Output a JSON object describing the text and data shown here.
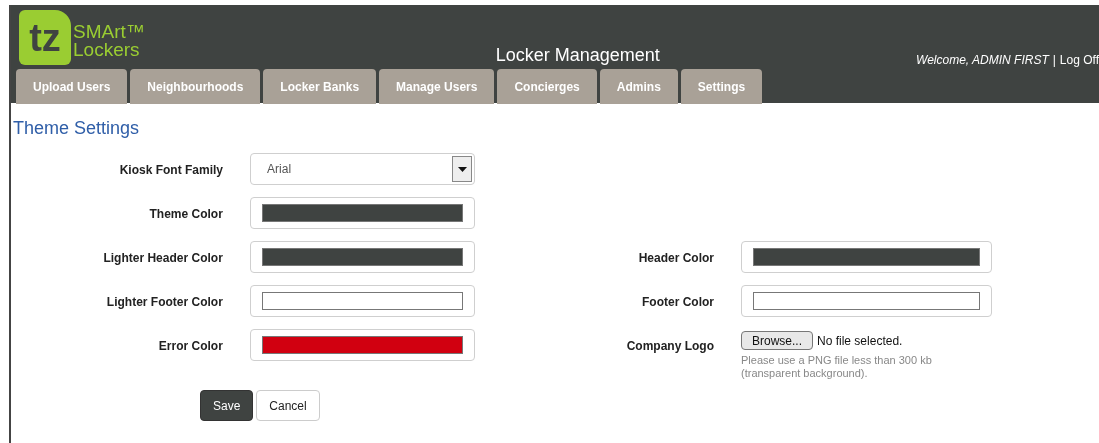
{
  "header": {
    "logo_mark": "tz",
    "logo_line_1": "SMArt™",
    "logo_line_2": "Lockers",
    "title": "Locker Management",
    "welcome": "Welcome, ADMIN FIRST",
    "separator": "|",
    "logout": "Log Off"
  },
  "tabs": [
    {
      "label": "Upload Users"
    },
    {
      "label": "Neighbourhoods"
    },
    {
      "label": "Locker Banks"
    },
    {
      "label": "Manage Users"
    },
    {
      "label": "Concierges"
    },
    {
      "label": "Admins"
    },
    {
      "label": "Settings"
    }
  ],
  "page_title": "Theme Settings",
  "rows": [
    {
      "left": {
        "kind": "select",
        "label": "Kiosk Font Family",
        "value": "Arial"
      }
    },
    {
      "left": {
        "kind": "color",
        "label": "Theme Color",
        "color": "#3f4341"
      }
    },
    {
      "left": {
        "kind": "color",
        "label": "Lighter Header Color",
        "color": "#3f4341"
      },
      "right": {
        "kind": "color",
        "label": "Header Color",
        "color": "#3f4341"
      }
    },
    {
      "left": {
        "kind": "color",
        "label": "Lighter Footer Color",
        "color": "#ffffff"
      },
      "right": {
        "kind": "color",
        "label": "Footer Color",
        "color": "#ffffff"
      }
    },
    {
      "left": {
        "kind": "color",
        "label": "Error Color",
        "color": "#d10010"
      },
      "right": {
        "kind": "file",
        "label": "Company Logo",
        "button": "Browse...",
        "status": "No file selected.",
        "hint": "Please use a PNG file less than 300 kb (transparent background)."
      }
    }
  ],
  "buttons": [
    {
      "label": "Save",
      "kind": "primary"
    },
    {
      "label": "Cancel",
      "kind": "secondary"
    }
  ]
}
